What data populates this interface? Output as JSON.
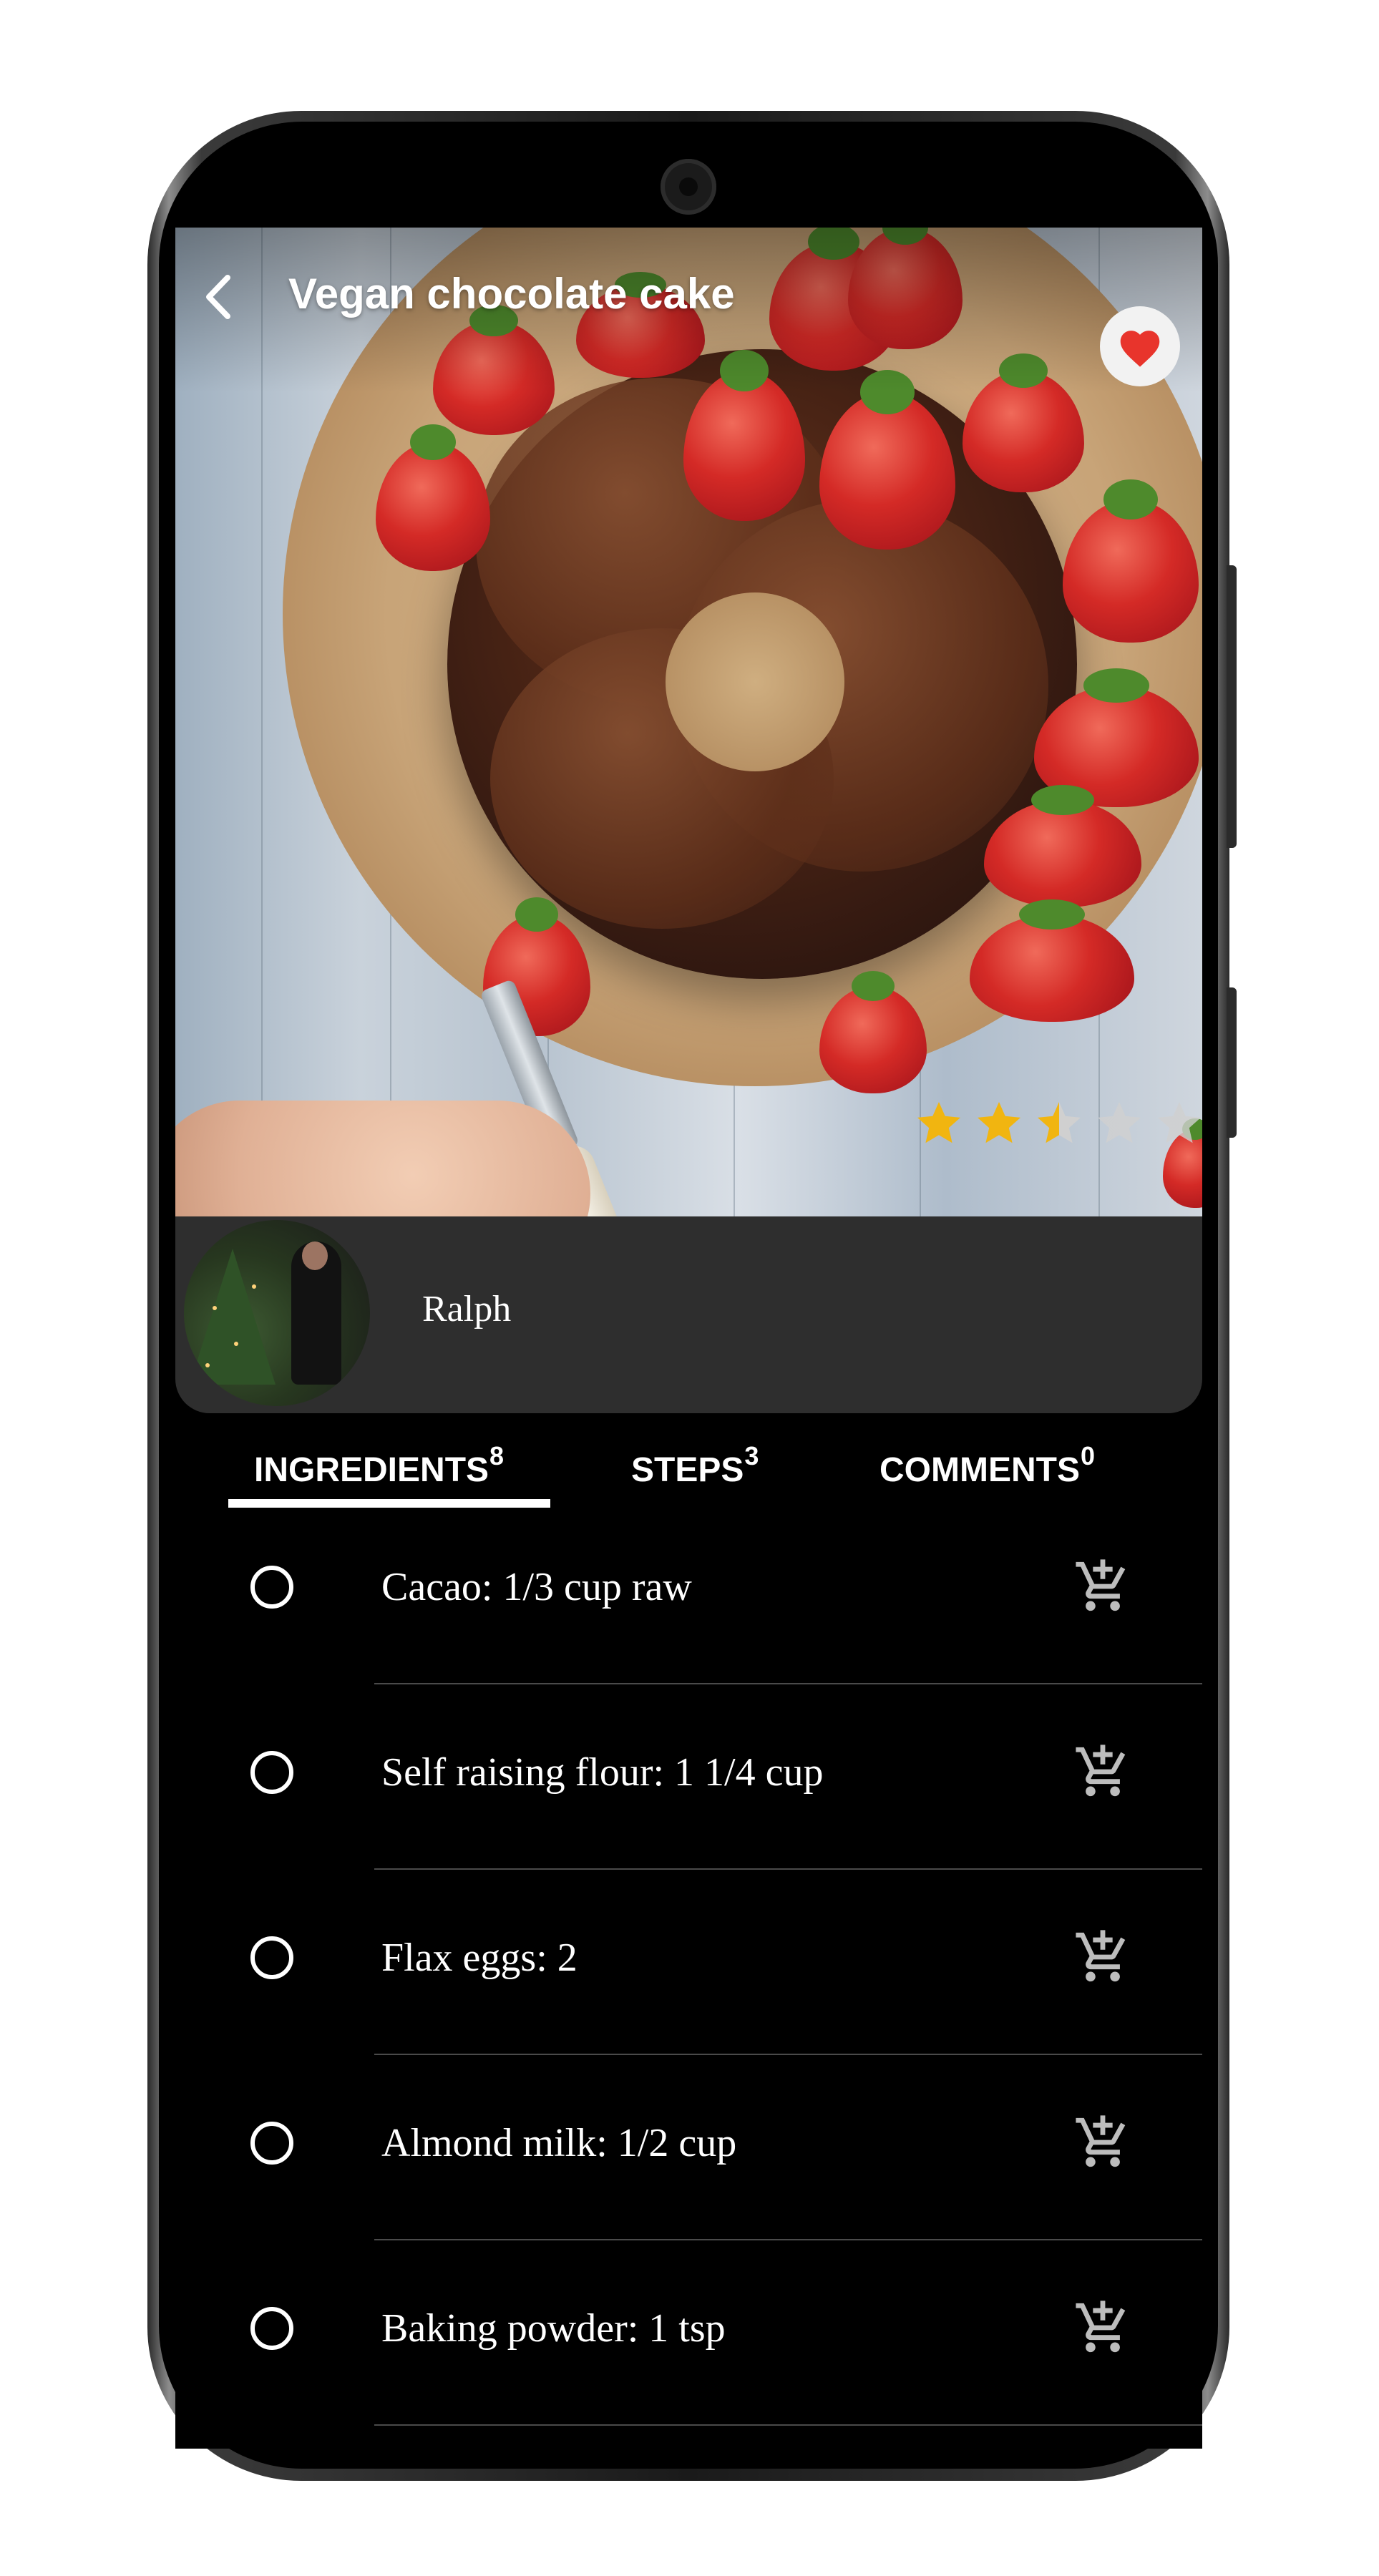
{
  "header": {
    "title": "Vegan chocolate cake",
    "back_icon": "chevron-left-icon",
    "favorite_icon": "heart-icon",
    "favorite_color": "#e8342c"
  },
  "rating": {
    "value": 2.5,
    "max": 5,
    "filled_color": "#f1b510",
    "empty_color": "#d0d0d0"
  },
  "author": {
    "name": "Ralph"
  },
  "tabs": [
    {
      "label": "INGREDIENTS",
      "count": "8",
      "active": true
    },
    {
      "label": "STEPS",
      "count": "3",
      "active": false
    },
    {
      "label": "COMMENTS",
      "count": "0",
      "active": false
    }
  ],
  "ingredients": [
    {
      "text": "Cacao: 1/3 cup raw"
    },
    {
      "text": "Self raising flour: 1 1/4 cup"
    },
    {
      "text": "Flax eggs: 2"
    },
    {
      "text": "Almond milk: 1/2 cup"
    },
    {
      "text": "Baking powder: 1 tsp"
    }
  ],
  "colors": {
    "background": "#000000",
    "author_bar": "#2e2e2e",
    "cart_icon": "#bdbdbd",
    "text": "#ffffff"
  }
}
